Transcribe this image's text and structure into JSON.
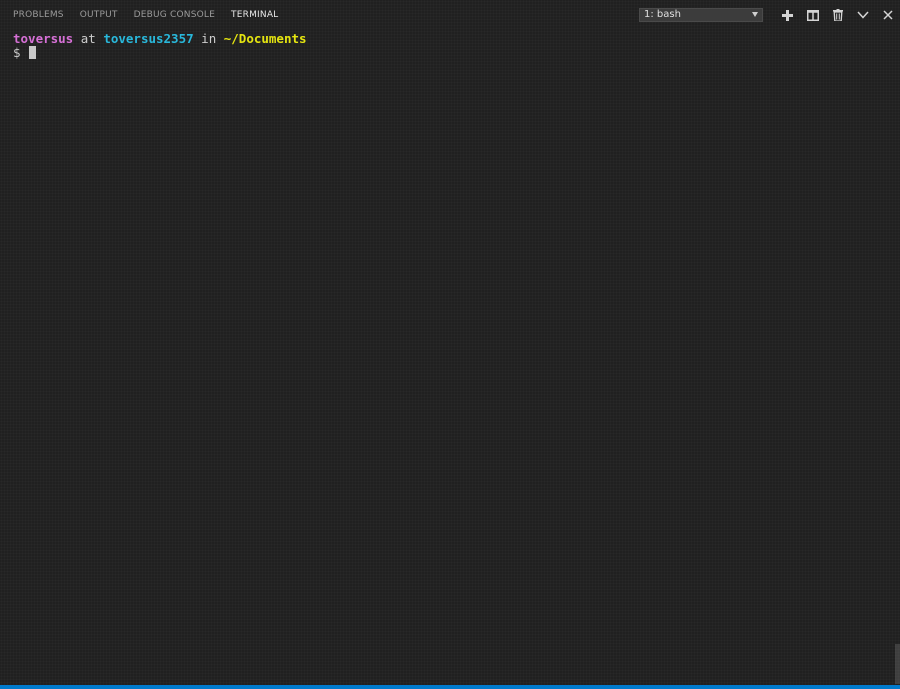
{
  "panel": {
    "tabs": [
      {
        "label": "PROBLEMS"
      },
      {
        "label": "OUTPUT"
      },
      {
        "label": "DEBUG CONSOLE"
      },
      {
        "label": "TERMINAL"
      }
    ],
    "active_tab": "TERMINAL",
    "terminal_select": {
      "value": "1: bash"
    },
    "actions": [
      {
        "icon": "plus-icon"
      },
      {
        "icon": "split-icon"
      },
      {
        "icon": "trash-icon"
      },
      {
        "icon": "chevron-down-icon"
      },
      {
        "icon": "close-icon"
      }
    ]
  },
  "terminal": {
    "prompt": {
      "user": "toversus",
      "at": " at ",
      "host": "toversus2357",
      "in": " in ",
      "dir": "~/Documents"
    },
    "input_prefix": "$"
  },
  "colors": {
    "user": "#d670d6",
    "host": "#29b8db",
    "dir": "#e5e510",
    "status_bar": "#007acc"
  }
}
